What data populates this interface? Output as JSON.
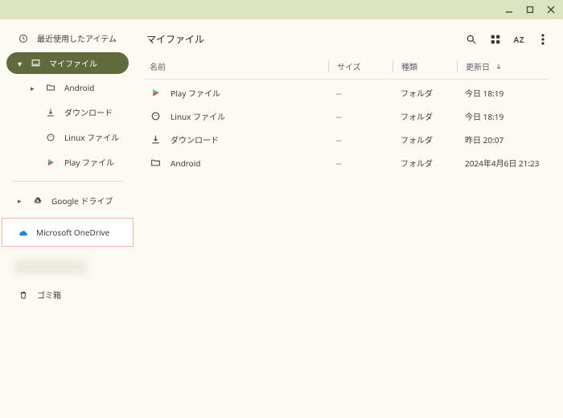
{
  "window": {
    "minimize": "_",
    "maximize": "□",
    "close": "×"
  },
  "sidebar": {
    "recent": "最近使用したアイテム",
    "myfiles": "マイファイル",
    "children": [
      {
        "label": "Android"
      },
      {
        "label": "ダウンロード"
      },
      {
        "label": "Linux ファイル"
      },
      {
        "label": "Play ファイル"
      }
    ],
    "gdrive": "Google ドライブ",
    "onedrive": "Microsoft OneDrive",
    "trash": "ゴミ箱"
  },
  "header": {
    "title": "マイファイル",
    "sort_label": "AZ"
  },
  "columns": {
    "name": "名前",
    "size": "サイズ",
    "kind": "種類",
    "date": "更新日"
  },
  "rows": [
    {
      "name": "Play ファイル",
      "size": "--",
      "kind": "フォルダ",
      "date": "今日 18:19"
    },
    {
      "name": "Linux ファイル",
      "size": "--",
      "kind": "フォルダ",
      "date": "今日 18:19"
    },
    {
      "name": "ダウンロード",
      "size": "--",
      "kind": "フォルダ",
      "date": "昨日 20:07"
    },
    {
      "name": "Android",
      "size": "--",
      "kind": "フォルダ",
      "date": "2024年4月6日 21:23"
    }
  ]
}
